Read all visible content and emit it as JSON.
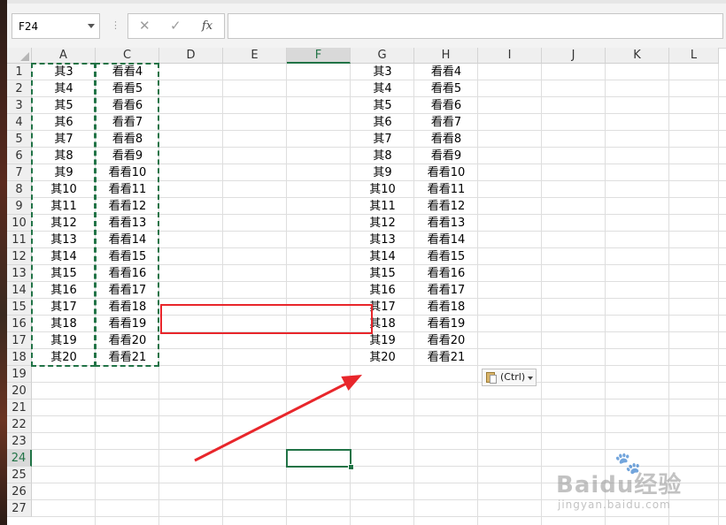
{
  "formula_bar": {
    "name_box": "F24",
    "cancel_icon": "✕",
    "enter_icon": "✓",
    "fx_label": "fx",
    "formula_value": ""
  },
  "columns": [
    "A",
    "C",
    "D",
    "E",
    "F",
    "G",
    "H",
    "I",
    "J",
    "K",
    "L"
  ],
  "active_column": "F",
  "rows": [
    "1",
    "2",
    "3",
    "4",
    "5",
    "6",
    "7",
    "8",
    "9",
    "10",
    "11",
    "12",
    "13",
    "14",
    "15",
    "16",
    "17",
    "18",
    "19",
    "20",
    "21",
    "22",
    "23",
    "24",
    "25",
    "26",
    "27"
  ],
  "active_row": "24",
  "col_A": [
    "其3",
    "其4",
    "其5",
    "其6",
    "其7",
    "其8",
    "其9",
    "其10",
    "其11",
    "其12",
    "其13",
    "其14",
    "其15",
    "其16",
    "其17",
    "其18",
    "其19",
    "其20"
  ],
  "col_C": [
    "看看4",
    "看看5",
    "看看6",
    "看看7",
    "看看8",
    "看看9",
    "看看10",
    "看看11",
    "看看12",
    "看看13",
    "看看14",
    "看看15",
    "看看16",
    "看看17",
    "看看18",
    "看看19",
    "看看20",
    "看看21"
  ],
  "col_G": [
    "其3",
    "其4",
    "其5",
    "其6",
    "其7",
    "其8",
    "其9",
    "其10",
    "其11",
    "其12",
    "其13",
    "其14",
    "其15",
    "其16",
    "其17",
    "其18",
    "其19",
    "其20"
  ],
  "col_H": [
    "看看4",
    "看看5",
    "看看6",
    "看看7",
    "看看8",
    "看看9",
    "看看10",
    "看看11",
    "看看12",
    "看看13",
    "看看14",
    "看看15",
    "看看16",
    "看看17",
    "看看18",
    "看看19",
    "看看20",
    "看看21"
  ],
  "paste_options": {
    "label": "(Ctrl)",
    "icon": "clipboard-icon"
  },
  "annotation_colors": {
    "highlight": "#e8262b",
    "accent": "#217346"
  },
  "watermark": {
    "brand": "Baidu经验",
    "url": "jingyan.baidu.com"
  }
}
